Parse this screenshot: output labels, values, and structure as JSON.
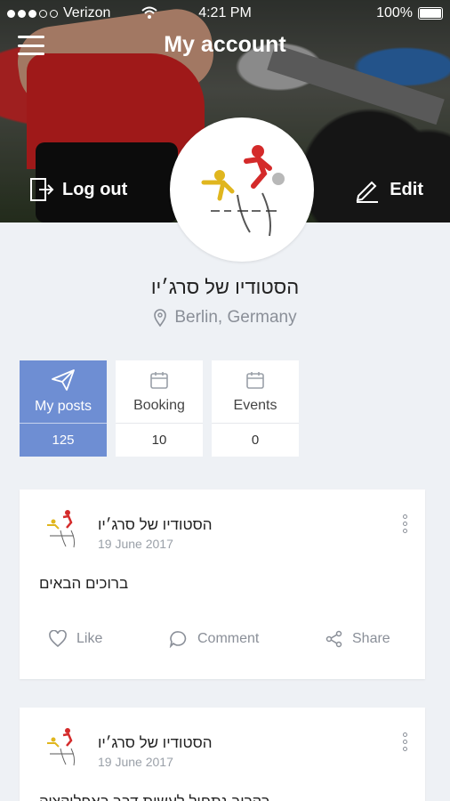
{
  "status_bar": {
    "carrier": "Verizon",
    "time": "4:21 PM",
    "battery": "100%"
  },
  "header": {
    "title": "My account",
    "logout_label": "Log out",
    "edit_label": "Edit"
  },
  "profile": {
    "name": "הסטודיו של סרג׳יו",
    "location": "Berlin, Germany"
  },
  "stats": [
    {
      "label": "My posts",
      "count": "125",
      "icon": "send-icon",
      "active": true
    },
    {
      "label": "Booking",
      "count": "10",
      "icon": "calendar-icon",
      "active": false
    },
    {
      "label": "Events",
      "count": "0",
      "icon": "calendar-icon",
      "active": false
    }
  ],
  "posts": [
    {
      "author": "הסטודיו של סרג׳יו",
      "date": "19 June 2017",
      "text": "ברוכים הבאים"
    },
    {
      "author": "הסטודיו של סרג׳יו",
      "date": "19 June 2017",
      "text": "בקרוב נתחיל לעשות דבר באפליקציה"
    }
  ],
  "actions": {
    "like": "Like",
    "comment": "Comment",
    "share": "Share"
  },
  "colors": {
    "accent": "#6e8ed3",
    "background": "#eef1f5",
    "muted": "#8a8f98"
  }
}
